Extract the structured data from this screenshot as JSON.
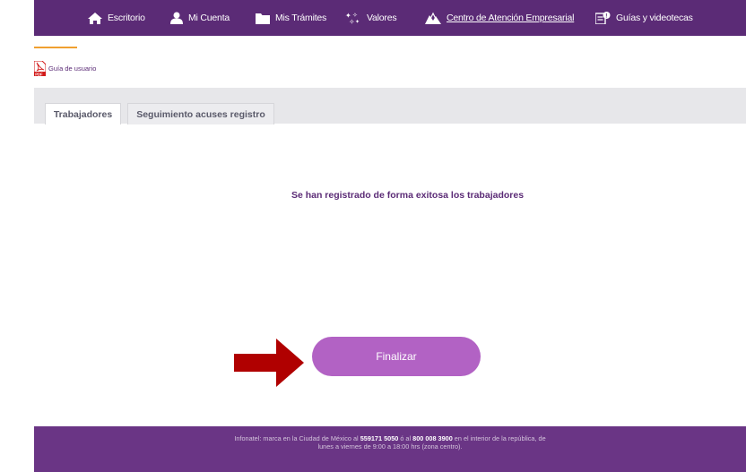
{
  "nav": {
    "items": [
      {
        "label": "Escritorio",
        "icon": "home-icon"
      },
      {
        "label": "Mi Cuenta",
        "icon": "user-icon"
      },
      {
        "label": "Mis Trámites",
        "icon": "folder-icon"
      },
      {
        "label": "Valores",
        "icon": "stars-icon"
      },
      {
        "label": "Centro de Atención Empresarial",
        "icon": "buildings-icon"
      },
      {
        "label": "Guías y videotecas",
        "icon": "guides-icon"
      }
    ]
  },
  "guide": {
    "label": "Guía de usuario",
    "icon": "pdf-icon"
  },
  "tabs": [
    {
      "label": "Trabajadores",
      "active": true
    },
    {
      "label": "Seguimiento acuses registro",
      "active": false
    }
  ],
  "main": {
    "success_message": "Se han registrado de forma exitosa los trabajadores",
    "finalizar_label": "Finalizar"
  },
  "footer": {
    "text_1": "Infonatel: marca en la Ciudad de México al ",
    "phone_1": "559171 5050",
    "text_2": " ó al ",
    "phone_2": "800 008 3900",
    "text_3": " en el interior de la república, de lunes a viernes de 9:00 a 18:00 hrs (zona centro)."
  },
  "colors": {
    "nav_bg": "#5b2b76",
    "accent": "#f0a030",
    "button": "#b262c4",
    "footer_bg": "#6a3585",
    "arrow": "#b00000"
  }
}
